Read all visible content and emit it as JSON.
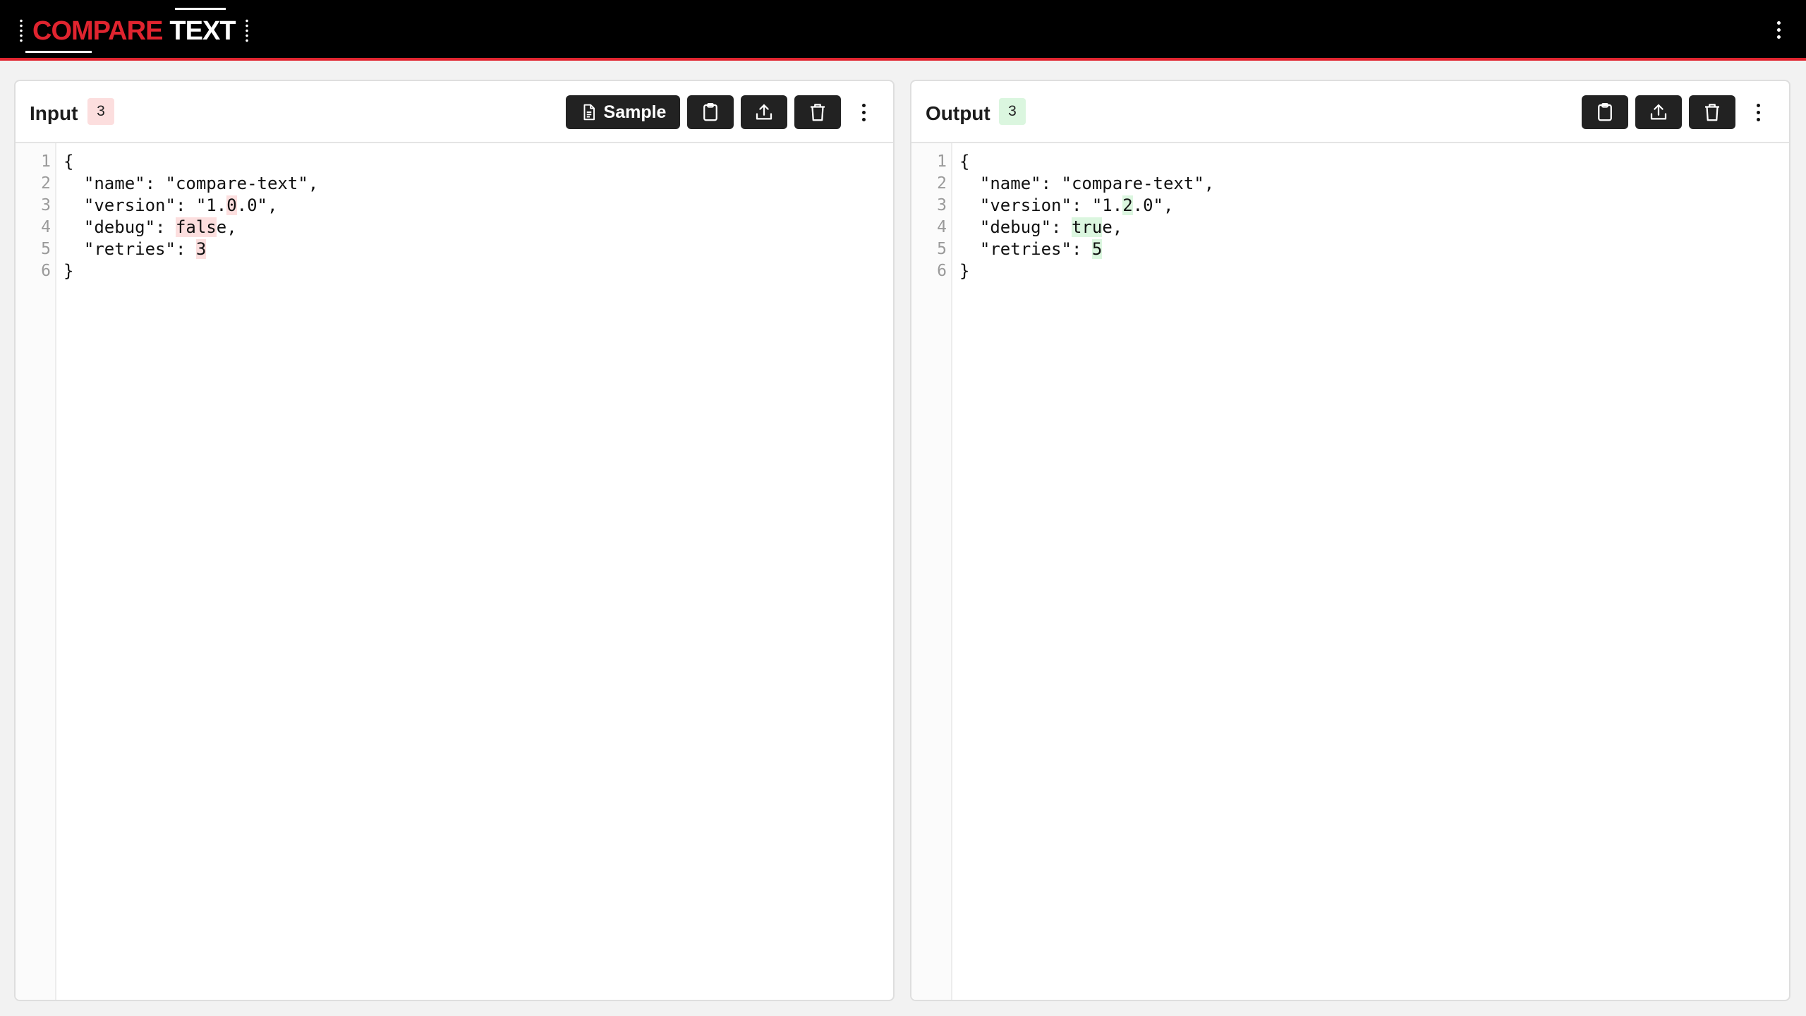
{
  "app": {
    "logo_part1": "COMPARE",
    "logo_part2": "TEXT"
  },
  "colors": {
    "brand_red": "#e0242f",
    "header_bg": "#000000",
    "deleted_bg": "#fcdede",
    "inserted_bg": "#dbf6df",
    "button_bg": "#222222"
  },
  "input": {
    "title": "Input",
    "count": "3",
    "sample_label": "Sample",
    "line_numbers": [
      "1",
      "2",
      "3",
      "4",
      "5",
      "6"
    ],
    "lines": {
      "l1": "{",
      "l2": "  \"name\": \"compare-text\",",
      "l3_a": "  \"version\": \"1.",
      "l3_diff": "0",
      "l3_b": ".0\",",
      "l4_a": "  \"debug\": ",
      "l4_diff": "fals",
      "l4_b": "e,",
      "l5_a": "  \"retries\": ",
      "l5_diff": "3",
      "l6": "}"
    }
  },
  "output": {
    "title": "Output",
    "count": "3",
    "line_numbers": [
      "1",
      "2",
      "3",
      "4",
      "5",
      "6"
    ],
    "lines": {
      "l1": "{",
      "l2": "  \"name\": \"compare-text\",",
      "l3_a": "  \"version\": \"1.",
      "l3_diff": "2",
      "l3_b": ".0\",",
      "l4_a": "  \"debug\": ",
      "l4_diff": "tru",
      "l4_b": "e,",
      "l5_a": "  \"retries\": ",
      "l5_diff": "5",
      "l6": "}"
    }
  },
  "icons": {
    "sample": "document-icon",
    "paste": "clipboard-icon",
    "upload": "upload-icon",
    "clear": "trash-icon",
    "menu": "kebab-menu-icon"
  }
}
